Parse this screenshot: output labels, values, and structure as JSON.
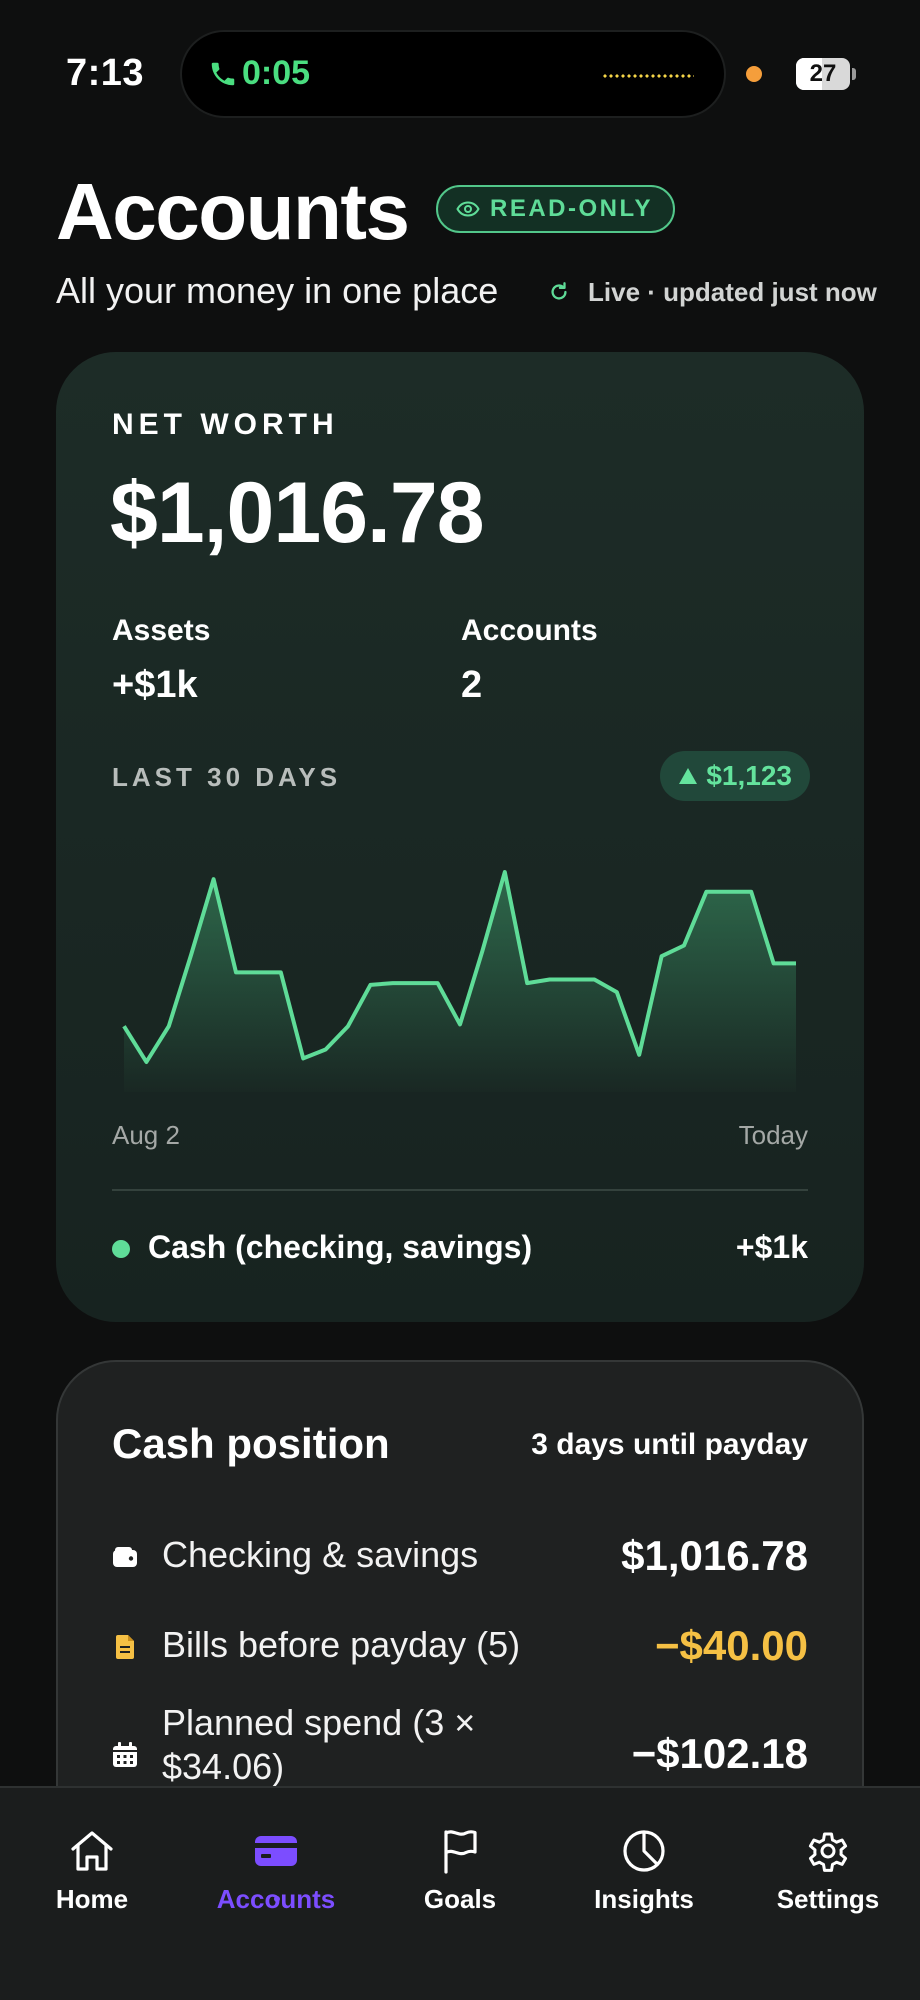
{
  "status_bar": {
    "time": "7:13",
    "call_timer": "0:05",
    "battery": "27"
  },
  "header": {
    "title": "Accounts",
    "badge": "READ-ONLY",
    "subtitle": "All your money in one place",
    "live_status": "Live · updated just now"
  },
  "net_worth": {
    "label": "NET WORTH",
    "value": "$1,016.78",
    "stats": [
      {
        "label": "Assets",
        "value": "+$1k"
      },
      {
        "label": "Accounts",
        "value": "2"
      }
    ],
    "chart_label": "LAST 30 DAYS",
    "change": "$1,123",
    "start_label": "Aug 2",
    "end_label": "Today",
    "legend": {
      "label": "Cash (checking, savings)",
      "value": "+$1k"
    },
    "colors": {
      "line": "#5fdc98",
      "accent": "#64e39d"
    }
  },
  "chart_data": {
    "type": "area",
    "title": "",
    "xlabel": "",
    "ylabel": "",
    "x": [
      "Aug 2",
      "",
      "",
      "",
      "",
      "",
      "",
      "",
      "",
      "",
      "",
      "",
      "",
      "",
      "",
      "",
      "",
      "",
      "",
      "",
      "",
      "",
      "",
      "",
      "",
      "",
      "",
      "",
      "",
      "",
      "Today"
    ],
    "y": [
      20,
      0,
      20,
      60,
      102,
      50,
      50,
      50,
      2,
      7,
      20,
      43,
      44,
      44,
      44,
      21,
      62,
      106,
      44,
      46,
      46,
      46,
      39,
      4,
      59,
      65,
      95,
      95,
      95,
      55,
      55
    ],
    "grid": false,
    "legend": "none"
  },
  "cash_position": {
    "title": "Cash position",
    "payday": "3 days until payday",
    "rows": [
      {
        "icon": "wallet-icon",
        "label": "Checking & savings",
        "value": "$1,016.78",
        "color": "#ffffff"
      },
      {
        "icon": "bill-icon",
        "label": "Bills before payday (5)",
        "value": "−$40.00",
        "color": "#f5c044"
      },
      {
        "icon": "calendar-icon",
        "label_line1": "Planned spend (3 ×",
        "label_line2": "$34.06)",
        "value": "−$102.18",
        "color": "#ffffff"
      }
    ]
  },
  "tab_bar": {
    "active": "Accounts",
    "active_color": "#7c4dff",
    "tabs": [
      {
        "label": "Home",
        "icon": "home-icon"
      },
      {
        "label": "Accounts",
        "icon": "card-icon"
      },
      {
        "label": "Goals",
        "icon": "flag-icon"
      },
      {
        "label": "Insights",
        "icon": "pie-chart-icon"
      },
      {
        "label": "Settings",
        "icon": "gear-icon"
      }
    ]
  }
}
